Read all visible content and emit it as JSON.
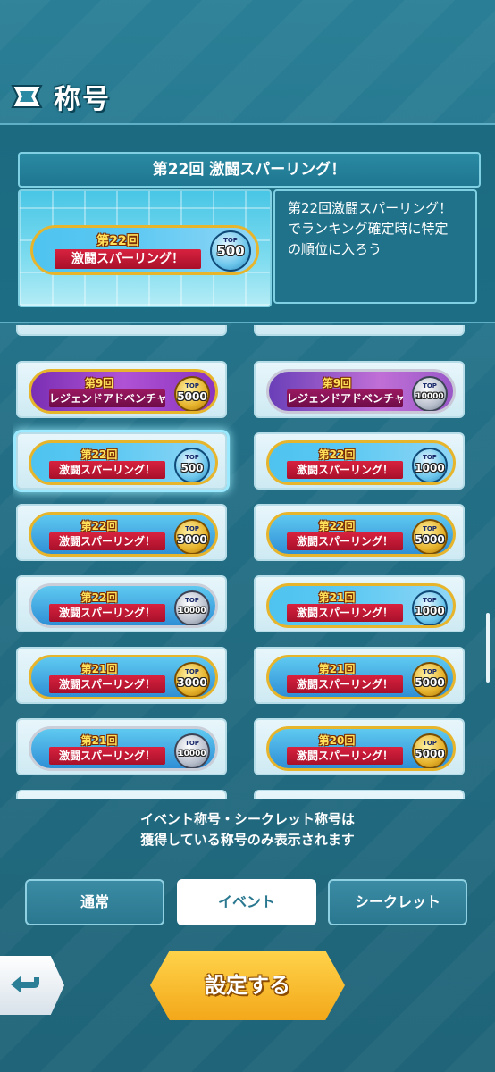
{
  "header": {
    "title": "称号"
  },
  "info": {
    "title": "第22回 激闘スパーリング！",
    "description_lines": [
      "第22回激闘スパーリング！",
      "でランキング確定時に特定",
      "の順位に入ろう"
    ],
    "preview": {
      "round": "第22回",
      "event": "激闘スパーリング！",
      "top": "TOP",
      "rank": "500"
    }
  },
  "titles": [
    {
      "round": "第9回",
      "event": "レジェンドアドベンチャー",
      "top": "TOP",
      "rank": "5000",
      "style": "purple",
      "medal": "gold"
    },
    {
      "round": "第9回",
      "event": "レジェンドアドベンチャー",
      "top": "TOP",
      "rank": "10000",
      "style": "lavender",
      "medal": "silver"
    },
    {
      "round": "第22回",
      "event": "激闘スパーリング！",
      "top": "TOP",
      "rank": "500",
      "style": "rainbow",
      "medal": "blue"
    },
    {
      "round": "第22回",
      "event": "激闘スパーリング！",
      "top": "TOP",
      "rank": "1000",
      "style": "rainbow",
      "medal": "blue"
    },
    {
      "round": "第22回",
      "event": "激闘スパーリング！",
      "top": "TOP",
      "rank": "3000",
      "style": "gold",
      "medal": "gold"
    },
    {
      "round": "第22回",
      "event": "激闘スパーリング！",
      "top": "TOP",
      "rank": "5000",
      "style": "gold",
      "medal": "gold"
    },
    {
      "round": "第22回",
      "event": "激闘スパーリング！",
      "top": "TOP",
      "rank": "10000",
      "style": "silver",
      "medal": "silver"
    },
    {
      "round": "第21回",
      "event": "激闘スパーリング！",
      "top": "TOP",
      "rank": "1000",
      "style": "rainbow",
      "medal": "blue"
    },
    {
      "round": "第21回",
      "event": "激闘スパーリング！",
      "top": "TOP",
      "rank": "3000",
      "style": "gold",
      "medal": "gold"
    },
    {
      "round": "第21回",
      "event": "激闘スパーリング！",
      "top": "TOP",
      "rank": "5000",
      "style": "gold",
      "medal": "gold"
    },
    {
      "round": "第21回",
      "event": "激闘スパーリング！",
      "top": "TOP",
      "rank": "10000",
      "style": "silver",
      "medal": "silver"
    },
    {
      "round": "第20回",
      "event": "激闘スパーリング！",
      "top": "TOP",
      "rank": "5000",
      "style": "gold",
      "medal": "gold"
    }
  ],
  "notice_lines": [
    "イベント称号・シークレット称号は",
    "獲得している称号のみ表示されます"
  ],
  "tabs": [
    {
      "label": "通常"
    },
    {
      "label": "イベント"
    },
    {
      "label": "シークレット"
    }
  ],
  "confirm_label": "設定する"
}
